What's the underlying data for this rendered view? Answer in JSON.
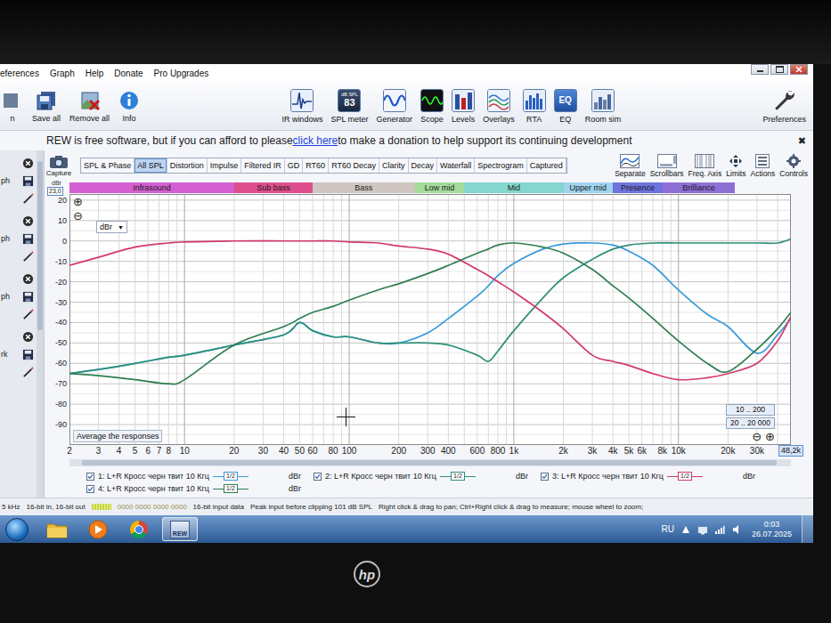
{
  "menu": [
    "eferences",
    "Graph",
    "Help",
    "Donate",
    "Pro Upgrades"
  ],
  "toolbar": {
    "left": [
      {
        "label": "n"
      },
      {
        "label": "Save all"
      },
      {
        "label": "Remove all"
      },
      {
        "label": "Info"
      }
    ],
    "center": [
      {
        "label": "IR windows"
      },
      {
        "label": "SPL meter",
        "icon_text": [
          "dB SPL",
          "83"
        ]
      },
      {
        "label": "Generator"
      },
      {
        "label": "Scope"
      },
      {
        "label": "Levels"
      },
      {
        "label": "Overlays"
      },
      {
        "label": "RTA"
      },
      {
        "label": "EQ",
        "icon_text": [
          "EQ"
        ]
      },
      {
        "label": "Room sim"
      }
    ],
    "right": {
      "label": "Preferences"
    }
  },
  "banner": {
    "before": "REW is free software, but if you can afford to please ",
    "link": "click here",
    "after": " to make a donation to help support its continuing development",
    "close": "✖"
  },
  "sidebar": {
    "items": [
      {
        "fragment": "ph"
      },
      {
        "fragment": "ph"
      },
      {
        "fragment": "ph"
      },
      {
        "fragment": "rk"
      }
    ]
  },
  "capture": {
    "label": "Capture"
  },
  "tabs": [
    {
      "label": "SPL & Phase",
      "selected": false
    },
    {
      "label": "All SPL",
      "selected": true
    },
    {
      "label": "Distortion",
      "selected": false
    },
    {
      "label": "Impulse",
      "selected": false
    },
    {
      "label": "Filtered IR",
      "selected": false
    },
    {
      "label": "GD",
      "selected": false
    },
    {
      "label": "RT60",
      "selected": false
    },
    {
      "label": "RT60 Decay",
      "selected": false
    },
    {
      "label": "Clarity",
      "selected": false
    },
    {
      "label": "Decay",
      "selected": false
    },
    {
      "label": "Waterfall",
      "selected": false
    },
    {
      "label": "Spectrogram",
      "selected": false
    },
    {
      "label": "Captured",
      "selected": false
    }
  ],
  "graph_controls": [
    {
      "label": "Separate"
    },
    {
      "label": "Scrollbars"
    },
    {
      "label": "Freq. Axis"
    },
    {
      "label": "Limits"
    },
    {
      "label": "Actions"
    },
    {
      "label": "Controls"
    }
  ],
  "chart": {
    "y_unit": "dBr",
    "y_top_value": "23,0",
    "y_max": 23,
    "y_min": -100,
    "x_min": 2,
    "x_max": 48200,
    "y_ticks": [
      {
        "label": "20",
        "value": 20
      },
      {
        "label": "10",
        "value": 10
      },
      {
        "label": "0",
        "value": 0
      },
      {
        "label": "-10",
        "value": -10
      },
      {
        "label": "-20",
        "value": -20
      },
      {
        "label": "-30",
        "value": -30
      },
      {
        "label": "-40",
        "value": -40
      },
      {
        "label": "-50",
        "value": -50
      },
      {
        "label": "-60",
        "value": -60
      },
      {
        "label": "-70",
        "value": -70
      },
      {
        "label": "-80",
        "value": -80
      },
      {
        "label": "-90",
        "value": -90
      }
    ],
    "x_ticks": [
      {
        "label": "2",
        "value": 2
      },
      {
        "label": "3",
        "value": 3
      },
      {
        "label": "4",
        "value": 4
      },
      {
        "label": "5",
        "value": 5
      },
      {
        "label": "6",
        "value": 6
      },
      {
        "label": "7",
        "value": 7
      },
      {
        "label": "8",
        "value": 8
      },
      {
        "label": "10",
        "value": 10
      },
      {
        "label": "20",
        "value": 20
      },
      {
        "label": "30",
        "value": 30
      },
      {
        "label": "40",
        "value": 40
      },
      {
        "label": "50",
        "value": 50
      },
      {
        "label": "60",
        "value": 60
      },
      {
        "label": "80",
        "value": 80
      },
      {
        "label": "100",
        "value": 100
      },
      {
        "label": "200",
        "value": 200
      },
      {
        "label": "300",
        "value": 300
      },
      {
        "label": "400",
        "value": 400
      },
      {
        "label": "600",
        "value": 600
      },
      {
        "label": "800",
        "value": 800
      },
      {
        "label": "1k",
        "value": 1000
      },
      {
        "label": "2k",
        "value": 2000
      },
      {
        "label": "3k",
        "value": 3000
      },
      {
        "label": "4k",
        "value": 4000
      },
      {
        "label": "5k",
        "value": 5000
      },
      {
        "label": "6k",
        "value": 6000
      },
      {
        "label": "8k",
        "value": 8000
      },
      {
        "label": "10k",
        "value": 10000
      },
      {
        "label": "20k",
        "value": 20000
      },
      {
        "label": "30k",
        "value": 30000
      }
    ],
    "x_end_label": "48,2k",
    "bands": [
      {
        "label": "Infrasound",
        "from": 2,
        "to": 20,
        "color": "#d35fd0"
      },
      {
        "label": "Sub bass",
        "from": 20,
        "to": 60,
        "color": "#df4e8c"
      },
      {
        "label": "Bass",
        "from": 60,
        "to": 250,
        "color": "#cfc6c2"
      },
      {
        "label": "Low mid",
        "from": 250,
        "to": 500,
        "color": "#a3dc9a"
      },
      {
        "label": "Mid",
        "from": 500,
        "to": 2000,
        "color": "#84d6cf"
      },
      {
        "label": "Upper mid",
        "from": 2000,
        "to": 4000,
        "color": "#9fd3ef"
      },
      {
        "label": "Presence",
        "from": 4000,
        "to": 8000,
        "color": "#6e73de"
      },
      {
        "label": "Brilliance",
        "from": 8000,
        "to": 22000,
        "color": "#8e6fd6"
      }
    ],
    "unit_dropdown": "dBr",
    "dropdown_arrow": "▼",
    "zoom_top": [
      "⊕",
      "⊖"
    ],
    "zoom_bottom": [
      "⊖",
      "⊕"
    ],
    "average_label": "Average the responses",
    "ranges": [
      "10 .. 200",
      "20 .. 20 000"
    ],
    "freqs": [
      2,
      3,
      5,
      8,
      10,
      20,
      40,
      50,
      60,
      80,
      100,
      150,
      200,
      300,
      400,
      600,
      700,
      800,
      1000,
      1500,
      2000,
      3000,
      4000,
      5000,
      7000,
      10000,
      15000,
      20000,
      30000,
      40000,
      48200
    ],
    "series": [
      {
        "label": "1: L+R Кросс черн твит 10 Кгц",
        "checked": true,
        "smoothing": "1/2",
        "unit": "dBr",
        "color": "#3a9ad8",
        "values": [
          -65,
          -63,
          -60,
          -57,
          -56,
          -51,
          -46,
          -40,
          -44,
          -47,
          -47,
          -50,
          -50,
          -45,
          -38,
          -27,
          -22,
          -17,
          -11,
          -4,
          -1.5,
          -1,
          -2,
          -5,
          -12,
          -24,
          -36,
          -42,
          -55,
          -46,
          -38
        ]
      },
      {
        "label": "2: L+R Кросс черн твит 10 Кгц",
        "checked": true,
        "smoothing": "1/2",
        "unit": "dBr",
        "color": "#2f8f7a",
        "values": [
          -65,
          -63,
          -60,
          -57,
          -56,
          -51,
          -46,
          -40,
          -44,
          -47,
          -47,
          -50,
          -50,
          -50,
          -51,
          -56,
          -59,
          -54,
          -44,
          -28,
          -18,
          -9,
          -4,
          -2,
          -1,
          -1,
          -1,
          -1,
          -1,
          -1,
          1
        ]
      },
      {
        "label": "3: L+R Кросс черн твит 10 Кгц",
        "checked": true,
        "smoothing": "1/2",
        "unit": "dBr",
        "color": "#d2386c",
        "values": [
          -12,
          -8,
          -3,
          -1,
          -0.5,
          0,
          0,
          0,
          0,
          0,
          -0.5,
          -1,
          -2.5,
          -4,
          -6.5,
          -14,
          -17,
          -20,
          -25,
          -35,
          -43,
          -56,
          -59,
          -61,
          -65,
          -68,
          -67,
          -65,
          -60,
          -49,
          -37
        ]
      },
      {
        "label": "4: L+R Кросс черн твит 10 Кгц",
        "checked": true,
        "smoothing": "1/2",
        "unit": "dBr",
        "color": "#2f7d4f",
        "values": [
          -65,
          -66,
          -68,
          -70,
          -68,
          -51,
          -42,
          -38,
          -35,
          -32,
          -29,
          -24,
          -21,
          -16,
          -12,
          -6,
          -4,
          -2,
          -1,
          -3,
          -6,
          -14,
          -22,
          -28,
          -38,
          -49,
          -60,
          -64,
          -53,
          -43,
          -35
        ]
      }
    ]
  },
  "status_bar": {
    "items": [
      "5 kHz",
      "16-bit in, 16-bit out",
      "0000 0000 0000 0000",
      "16-bit input data",
      "Peak input before clipping 101 dB SPL",
      "Right click & drag to pan; Ctrl+Right click & drag to measure; mouse wheel to zoom;"
    ]
  },
  "taskbar": {
    "apps": [
      {
        "selected": false
      },
      {
        "selected": false
      },
      {
        "selected": false
      },
      {
        "selected": true,
        "icon_text": "REW"
      }
    ],
    "language": "RU",
    "time": "0:03",
    "date": "26.07.2025"
  },
  "bezel": {
    "logo": "hp"
  }
}
